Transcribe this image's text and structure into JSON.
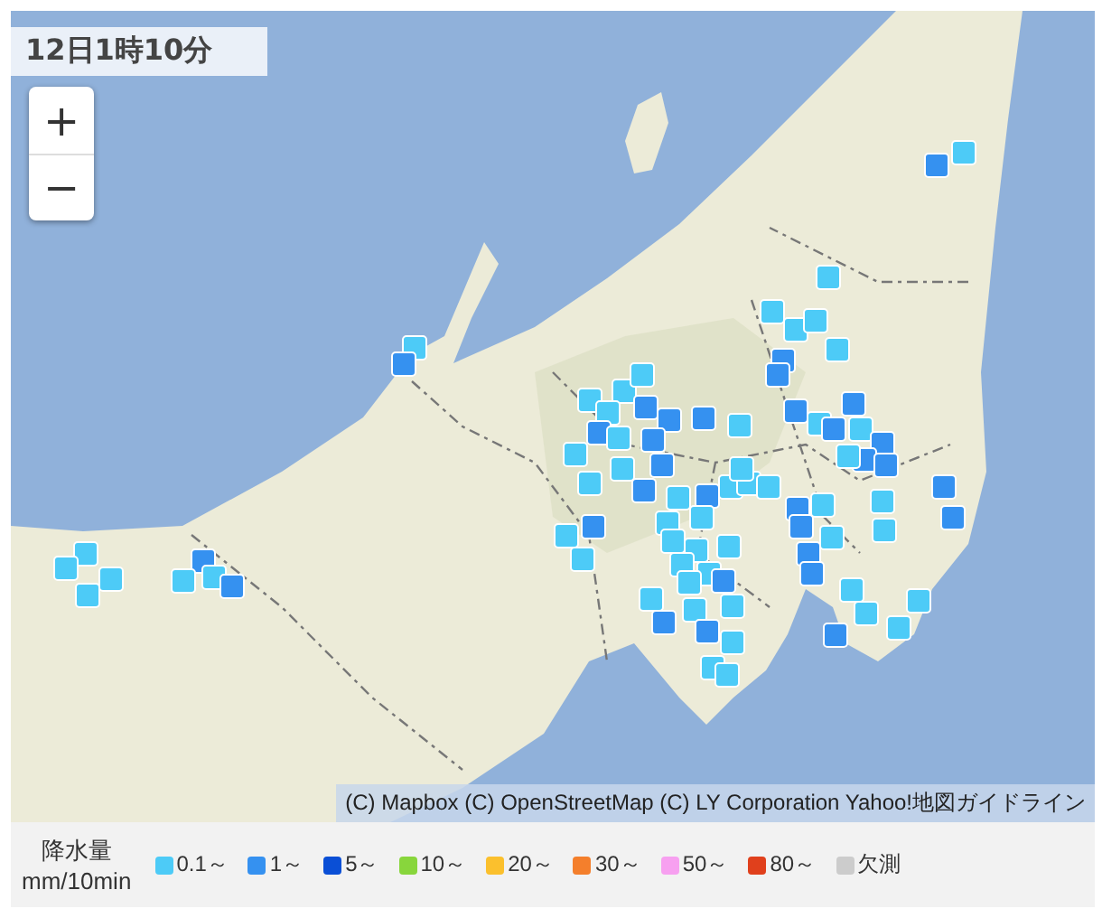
{
  "timestamp": "12日1時10分",
  "zoom_controls": [
    {
      "label": "+"
    },
    {
      "label": "−"
    }
  ],
  "attribution": "(C) Mapbox (C) OpenStreetMap (C) LY Corporation Yahoo!地図ガイドライン",
  "legend": {
    "title": "降水量",
    "unit": "mm/10min",
    "items": [
      {
        "label": "0.1～",
        "color": "#4dcbf7"
      },
      {
        "label": "1～",
        "color": "#3591f0"
      },
      {
        "label": "5～",
        "color": "#0a4fd6"
      },
      {
        "label": "10～",
        "color": "#88d63c"
      },
      {
        "label": "20～",
        "color": "#fbc02d"
      },
      {
        "label": "30～",
        "color": "#f47f2c"
      },
      {
        "label": "50～",
        "color": "#f7a0f0"
      },
      {
        "label": "80～",
        "color": "#e0401c"
      },
      {
        "label": "欠測",
        "color": "#cccccc"
      }
    ]
  }
}
